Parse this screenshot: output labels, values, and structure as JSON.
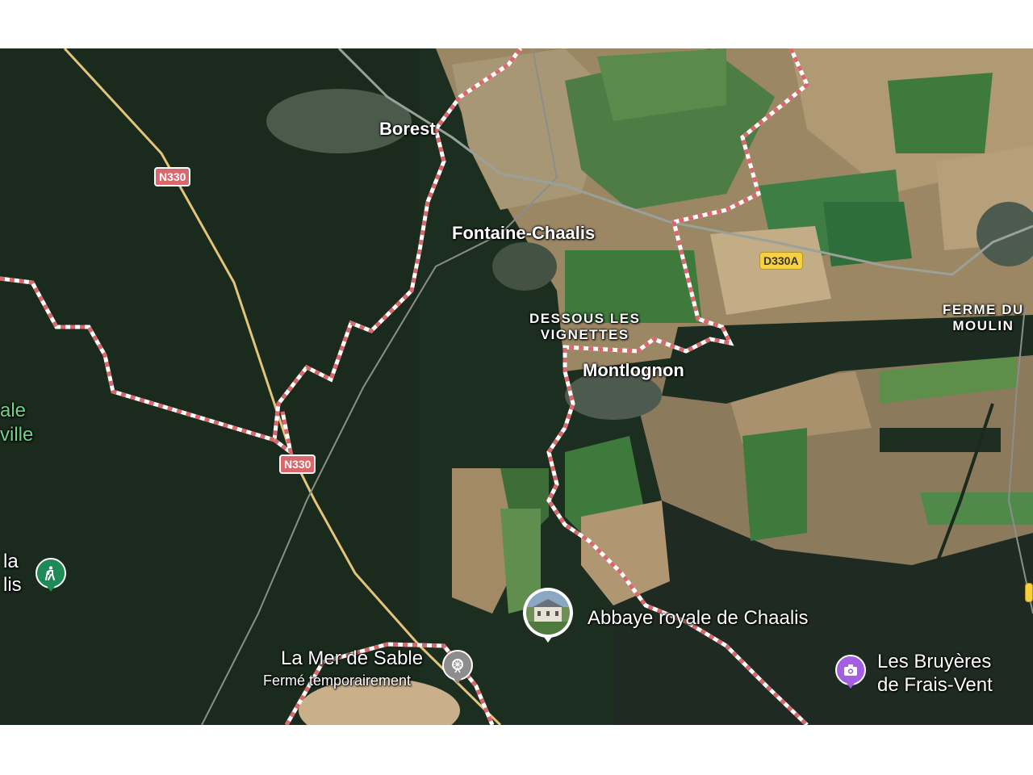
{
  "map": {
    "towns": {
      "borest": "Borest",
      "fontaine": "Fontaine-Chaalis",
      "montlognon": "Montlognon"
    },
    "localities": {
      "dessous_line1": "DESSOUS LES",
      "dessous_line2": "VIGNETTES",
      "ferme_line1": "FERME DU",
      "ferme_line2": "MOULIN"
    },
    "roads": {
      "n330_top": "N330",
      "n330_bottom": "N330",
      "d330a": "D330A"
    },
    "edge_labels": {
      "left_green_1": "ale",
      "left_green_2": "ville",
      "left_white_1": "la",
      "left_white_2": "lis"
    },
    "pois": {
      "abbaye": "Abbaye royale de Chaalis",
      "mer_name": "La Mer de Sable",
      "mer_status": "Fermé temporairement",
      "bruyeres_line1": "Les Bruyères",
      "bruyeres_line2": "de Frais-Vent"
    },
    "icons": {
      "hiking": "hiking-icon",
      "theme_park": "theme-park-icon",
      "photo": "camera-icon",
      "abbaye_photo": "abbey-thumbnail"
    },
    "colors": {
      "boundary": "#d9676b",
      "forest": "#1f3322",
      "field_tan": "#a8906b",
      "field_green": "#3f7a3d",
      "road_main": "#e3c47a",
      "road_minor": "#8a8f8a",
      "poi_green": "#1e8a57",
      "poi_grey": "#8d8d8d",
      "poi_purple": "#a45ee0"
    }
  }
}
